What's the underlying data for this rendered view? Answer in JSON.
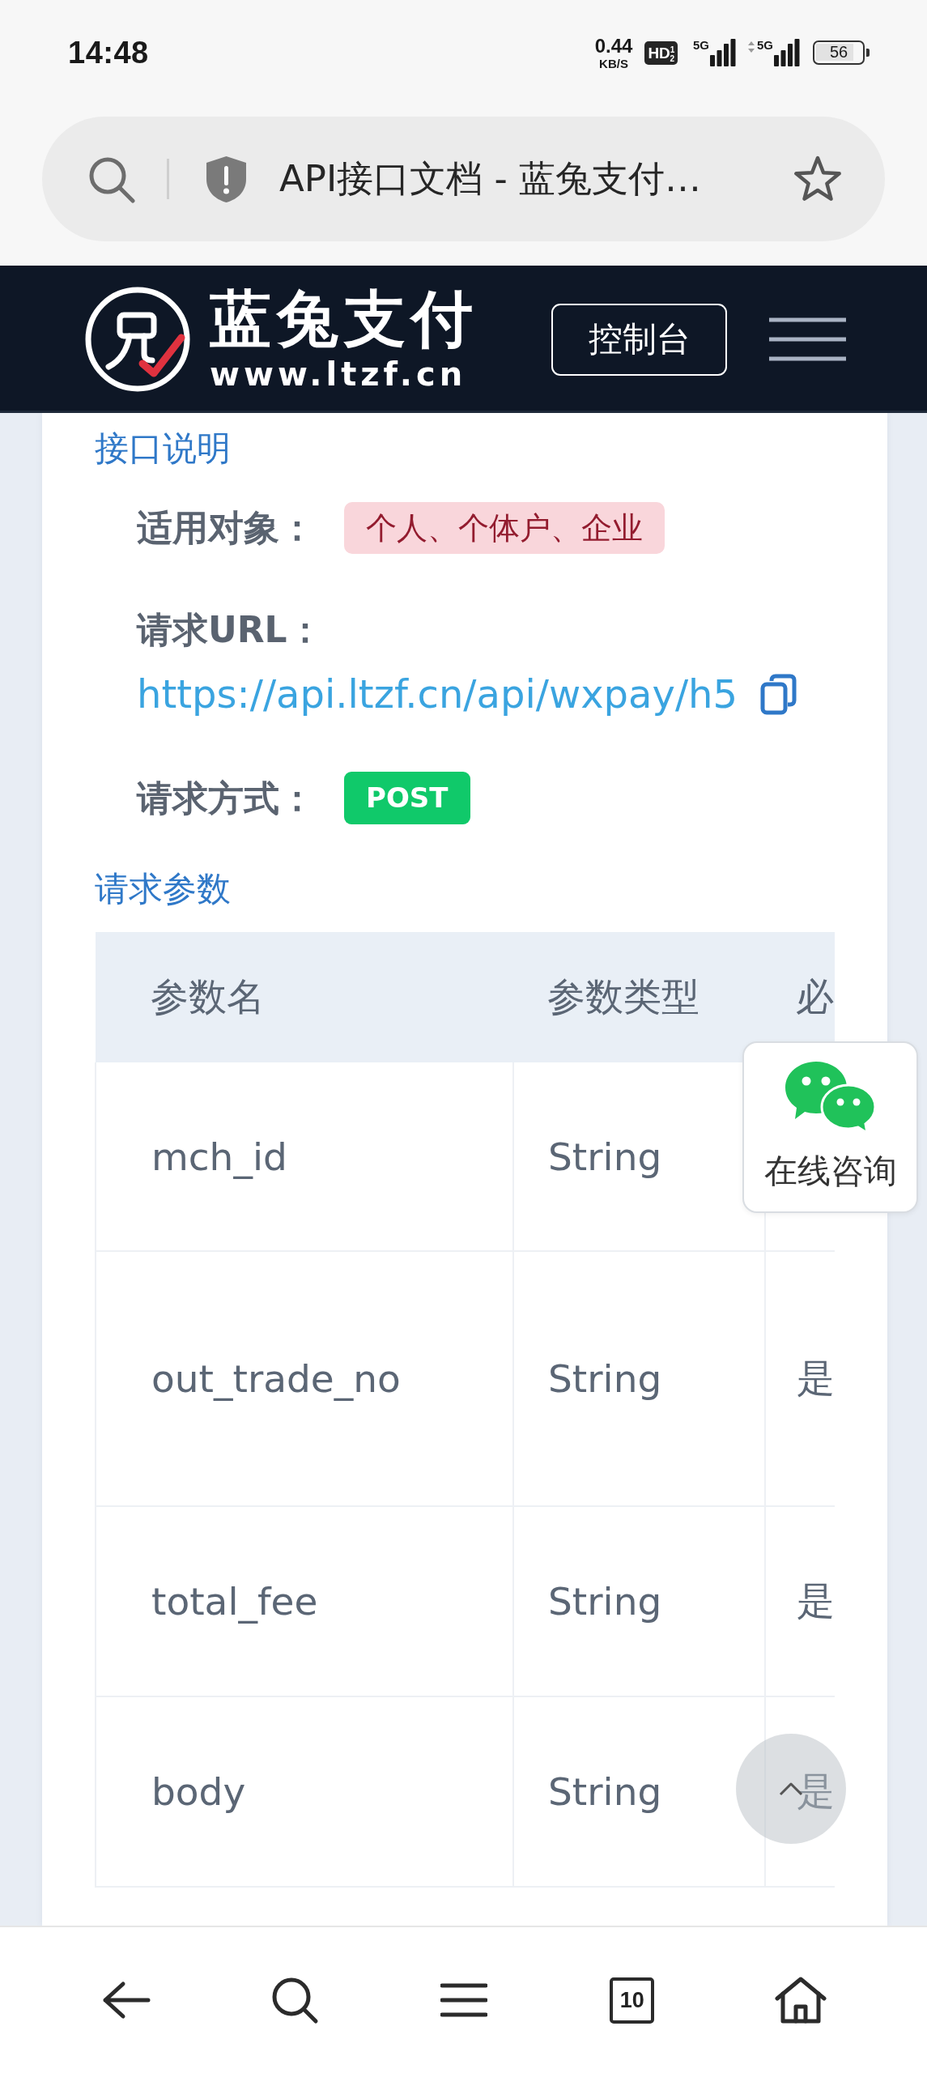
{
  "status_bar": {
    "time": "14:48",
    "net_speed": "0.44",
    "net_speed_unit": "KB/S",
    "hd_badge": "HD$^{1}$$_{2}$",
    "signals": [
      {
        "label": "5G",
        "activity": false
      },
      {
        "label": "5G",
        "activity": true
      }
    ],
    "battery": "56"
  },
  "browser": {
    "page_title": "API接口文档 - 蓝兔支付…"
  },
  "site_header": {
    "brand": "蓝兔支付",
    "domain": "www.ltzf.cn",
    "console_button": "控制台"
  },
  "sections": [
    {
      "title": "接口说明",
      "fields": [
        {
          "kind": "tag",
          "label": "适用对象：",
          "value": "个人、个体户、企业"
        },
        {
          "kind": "url",
          "label": "请求URL：",
          "value": "https://api.ltzf.cn/api/wxpay/h5"
        },
        {
          "kind": "method",
          "label": "请求方式：",
          "value": "POST"
        }
      ]
    },
    {
      "title": "请求参数",
      "table": {
        "columns": [
          "参数名",
          "参数类型",
          "必"
        ],
        "rows": [
          [
            "mch_id",
            "String"
          ],
          [
            "out_trade_no",
            "String",
            "是"
          ],
          [
            "total_fee",
            "String",
            "是"
          ],
          [
            "body",
            "String",
            "是"
          ]
        ]
      }
    }
  ],
  "chat_widget": {
    "label": "在线咨询"
  },
  "bottom_nav": {
    "tab_count": "10"
  }
}
